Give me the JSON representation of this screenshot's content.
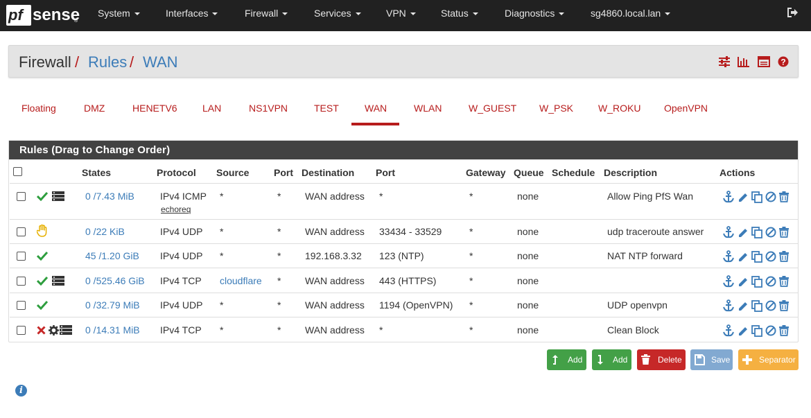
{
  "navbar": {
    "brand_pf": "pf",
    "brand_sense": "sense",
    "brand_tm": "®",
    "menus": [
      {
        "label": "System"
      },
      {
        "label": "Interfaces"
      },
      {
        "label": "Firewall"
      },
      {
        "label": "Services"
      },
      {
        "label": "VPN"
      },
      {
        "label": "Status"
      },
      {
        "label": "Diagnostics"
      },
      {
        "label": "sg4860.local.lan"
      }
    ],
    "logout_icon": "sign-out-icon"
  },
  "breadcrumb": {
    "items": [
      "Firewall",
      "Rules",
      "WAN"
    ],
    "separator": "/",
    "icons": [
      "sliders-icon",
      "bar-chart-icon",
      "list-table-icon",
      "help-icon"
    ]
  },
  "tabs": {
    "items": [
      "Floating",
      "DMZ",
      "HENETV6",
      "LAN",
      "NS1VPN",
      "TEST",
      "WAN",
      "WLAN",
      "W_GUEST",
      "W_PSK",
      "W_ROKU",
      "OpenVPN"
    ],
    "active": "WAN"
  },
  "panel": {
    "title": "Rules (Drag to Change Order)",
    "columns": [
      "States",
      "Protocol",
      "Source",
      "Port",
      "Destination",
      "Port",
      "Gateway",
      "Queue",
      "Schedule",
      "Description",
      "Actions"
    ],
    "rows": [
      {
        "status": "pass",
        "log": true,
        "advanced": false,
        "states": "0 /7.43 MiB",
        "protocol": "IPv4 ICMP",
        "protocol_sub": "echoreq",
        "source": "*",
        "source_link": false,
        "sport": "*",
        "destination": "WAN address",
        "dport": "*",
        "gateway": "*",
        "queue": "none",
        "schedule": "",
        "description": "Allow Ping PfS Wan"
      },
      {
        "status": "paused",
        "log": false,
        "advanced": false,
        "states": "0 /22 KiB",
        "protocol": "IPv4 UDP",
        "protocol_sub": "",
        "source": "*",
        "source_link": false,
        "sport": "*",
        "destination": "WAN address",
        "dport": "33434 - 33529",
        "gateway": "*",
        "queue": "none",
        "schedule": "",
        "description": "udp traceroute answer"
      },
      {
        "status": "pass",
        "log": false,
        "advanced": false,
        "states": "45 /1.20 GiB",
        "protocol": "IPv4 UDP",
        "protocol_sub": "",
        "source": "*",
        "source_link": false,
        "sport": "*",
        "destination": "192.168.3.32",
        "dport": "123 (NTP)",
        "gateway": "*",
        "queue": "none",
        "schedule": "",
        "description": "NAT NTP forward"
      },
      {
        "status": "pass",
        "log": true,
        "advanced": false,
        "states": "0 /525.46 GiB",
        "protocol": "IPv4 TCP",
        "protocol_sub": "",
        "source": "cloudflare",
        "source_link": true,
        "sport": "*",
        "destination": "WAN address",
        "dport": "443 (HTTPS)",
        "gateway": "*",
        "queue": "none",
        "schedule": "",
        "description": ""
      },
      {
        "status": "pass",
        "log": false,
        "advanced": false,
        "states": "0 /32.79 MiB",
        "protocol": "IPv4 UDP",
        "protocol_sub": "",
        "source": "*",
        "source_link": false,
        "sport": "*",
        "destination": "WAN address",
        "dport": "1194 (OpenVPN)",
        "gateway": "*",
        "queue": "none",
        "schedule": "",
        "description": "UDP openvpn"
      },
      {
        "status": "block",
        "log": true,
        "advanced": true,
        "states": "0 /14.31 MiB",
        "protocol": "IPv4 TCP",
        "protocol_sub": "",
        "source": "*",
        "source_link": false,
        "sport": "*",
        "destination": "WAN address",
        "dport": "*",
        "gateway": "*",
        "queue": "none",
        "schedule": "",
        "description": "Clean Block"
      }
    ],
    "row_actions": [
      "anchor-icon",
      "pencil-icon",
      "copy-icon",
      "disable-icon",
      "trash-icon"
    ]
  },
  "buttons": {
    "add_top": "Add",
    "add_bottom": "Add",
    "delete": "Delete",
    "save": "Save",
    "separator": "Separator"
  },
  "colors": {
    "navbar": "#212121",
    "brand_red": "#b71c1c",
    "link_blue": "#3c7cb8",
    "pass_green": "#2e9e3e",
    "block_red": "#c62828",
    "paused_yellow": "#e6b000",
    "btn_success": "#43a047",
    "btn_danger": "#c62828",
    "btn_save": "#82a9d1",
    "btn_warning": "#f5b041"
  },
  "footer": {
    "info_icon": "info-circle-icon",
    "info_glyph": "i"
  }
}
